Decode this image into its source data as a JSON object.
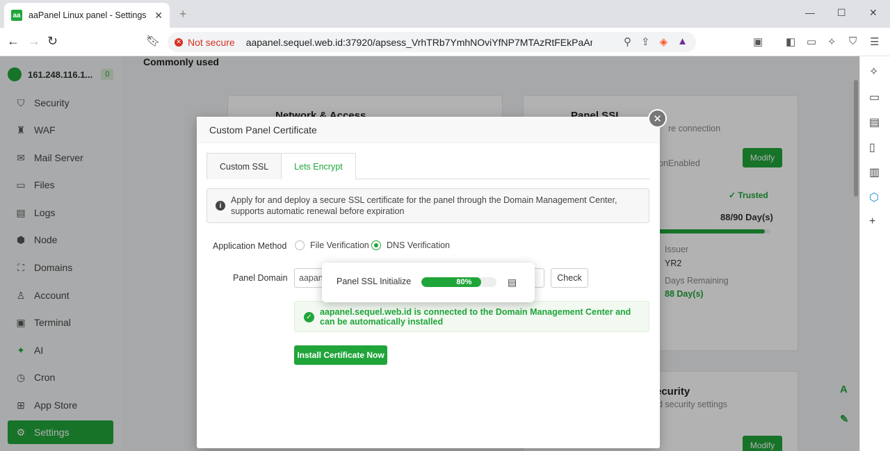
{
  "browser": {
    "tab_icon": "aa",
    "tab_title": "aaPanel Linux panel - Settings",
    "security_label": "Not secure",
    "url": "aapanel.sequel.web.id:37920/apsess_VrhTRb7YmhNOviYfNP7MTAzRtFEkPaAm/..."
  },
  "sidebar": {
    "host": "161.248.116.1...",
    "badge": "0",
    "items": [
      {
        "label": "Security",
        "icon": "shield-icon"
      },
      {
        "label": "WAF",
        "icon": "waf-icon"
      },
      {
        "label": "Mail Server",
        "icon": "mail-icon"
      },
      {
        "label": "Files",
        "icon": "folder-icon"
      },
      {
        "label": "Logs",
        "icon": "log-icon"
      },
      {
        "label": "Node",
        "icon": "node-icon"
      },
      {
        "label": "Domains",
        "icon": "domains-icon"
      },
      {
        "label": "Account",
        "icon": "user-icon"
      },
      {
        "label": "Terminal",
        "icon": "terminal-icon"
      },
      {
        "label": "AI",
        "icon": "ai-icon"
      },
      {
        "label": "Cron",
        "icon": "clock-icon"
      },
      {
        "label": "App Store",
        "icon": "store-icon"
      },
      {
        "label": "Settings",
        "icon": "gear-icon"
      }
    ]
  },
  "page": {
    "section_title": "Commonly used",
    "card_network_title": "Network & Access",
    "card_ssl_title": "Panel SSL",
    "card_ssl_sub": "re connection",
    "card_ssl_status": "onEnabled",
    "modify_label": "Modify",
    "trusted_label": "Trusted",
    "days_label": "88/90 Day(s)",
    "days_progress": 0.978,
    "issuer_label": "Issuer",
    "issuer_value": "YR2",
    "remaining_label": "Days Remaining",
    "remaining_value": "88 Day(s)",
    "card_security_title": "ecurity",
    "card_security_sub": "d security settings"
  },
  "modal": {
    "title": "Custom Panel Certificate",
    "tabs": [
      "Custom SSL",
      "Lets Encrypt"
    ],
    "active_tab": "Lets Encrypt",
    "info_text": "Apply for and deploy a secure SSL certificate for the panel through the Domain Management Center, supports automatic renewal before expiration",
    "method_label": "Application Method",
    "method_options": [
      "File Verification",
      "DNS Verification"
    ],
    "selected_method": "DNS Verification",
    "domain_label": "Panel Domain",
    "domain_value": "aapane",
    "check_label": "Check",
    "success_text": "aapanel.sequel.web.id is connected to the Domain Management Center and can be automatically installed",
    "install_label": "Install Certificate Now"
  },
  "progress_popup": {
    "label": "Panel SSL Initialize",
    "percent_text": "80%",
    "percent": 80
  }
}
